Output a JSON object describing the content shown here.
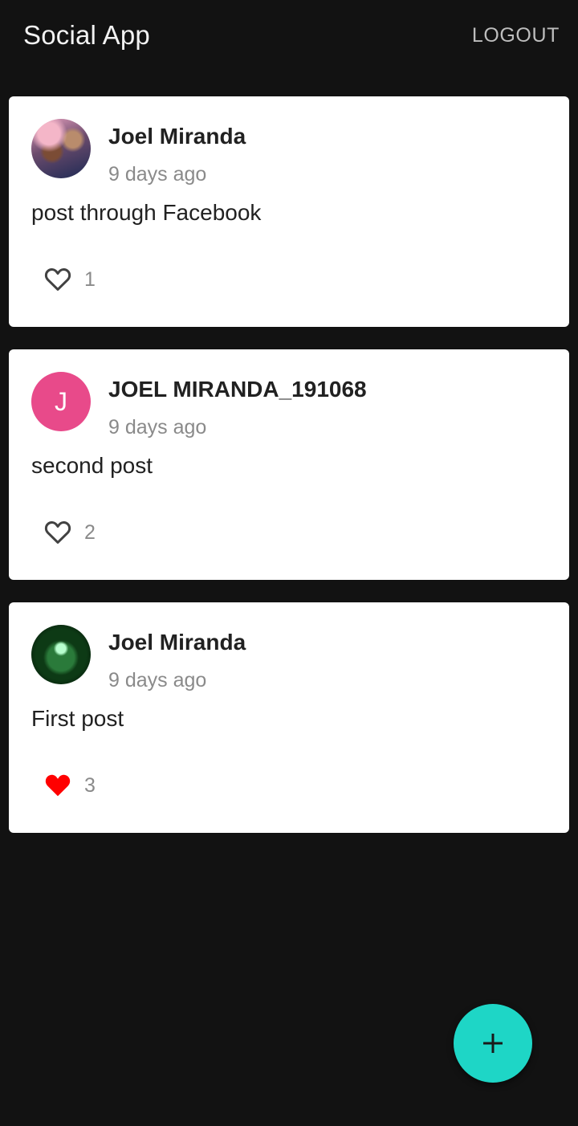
{
  "app_bar": {
    "title": "Social App",
    "logout_label": "LOGOUT"
  },
  "posts": [
    {
      "author": "Joel Miranda",
      "time": "9 days ago",
      "body": "post through Facebook",
      "likes": "1",
      "liked": false,
      "avatar": "photo-avatar"
    },
    {
      "author": "JOEL MIRANDA_191068",
      "time": "9 days ago",
      "body": "second post",
      "likes": "2",
      "liked": false,
      "avatar": "J",
      "avatar_color": "#e84a8a"
    },
    {
      "author": "Joel Miranda",
      "time": "9 days ago",
      "body": "First post",
      "likes": "3",
      "liked": true,
      "avatar": "photo-avatar"
    }
  ],
  "colors": {
    "background": "#121212",
    "card": "#ffffff",
    "fab": "#1ed6c6",
    "like_active": "#ff0000"
  },
  "fab": {
    "icon": "plus-icon"
  }
}
